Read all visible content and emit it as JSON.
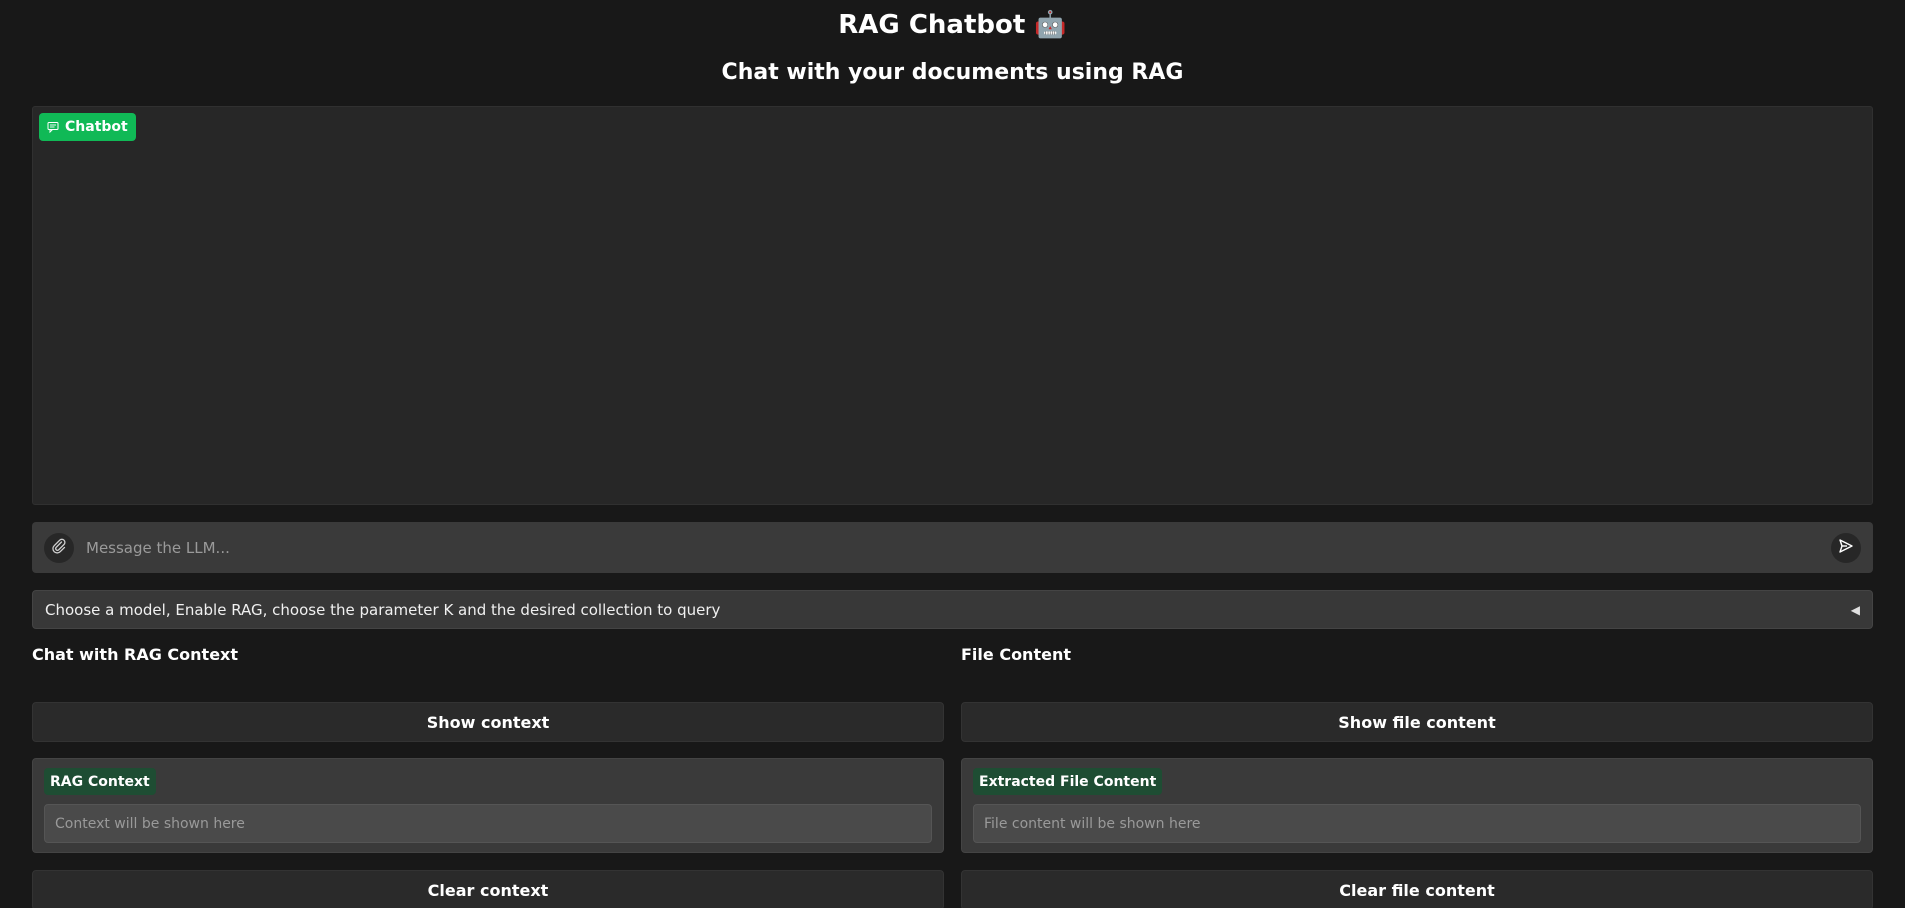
{
  "header": {
    "title": "RAG Chatbot 🤖",
    "subtitle": "Chat with your documents using RAG"
  },
  "chatbot": {
    "badge_label": "Chatbot",
    "badge_icon": "chat-bubble-icon",
    "accent": "#10b956"
  },
  "composer": {
    "placeholder": "Message the LLM...",
    "attach_icon": "paperclip-icon",
    "send_icon": "send-icon"
  },
  "settings_accordion": {
    "label": "Choose a model, Enable RAG, choose the parameter K and the desired collection to query",
    "arrow": "◀"
  },
  "rag_section": {
    "title": "Chat with RAG Context",
    "show_button": "Show context",
    "panel_label": "RAG Context",
    "panel_placeholder": "Context will be shown here",
    "clear_button": "Clear context"
  },
  "file_section": {
    "title": "File Content",
    "show_button": "Show file content",
    "panel_label": "Extracted File Content",
    "panel_placeholder": "File content will be shown here",
    "clear_button": "Clear file content"
  }
}
